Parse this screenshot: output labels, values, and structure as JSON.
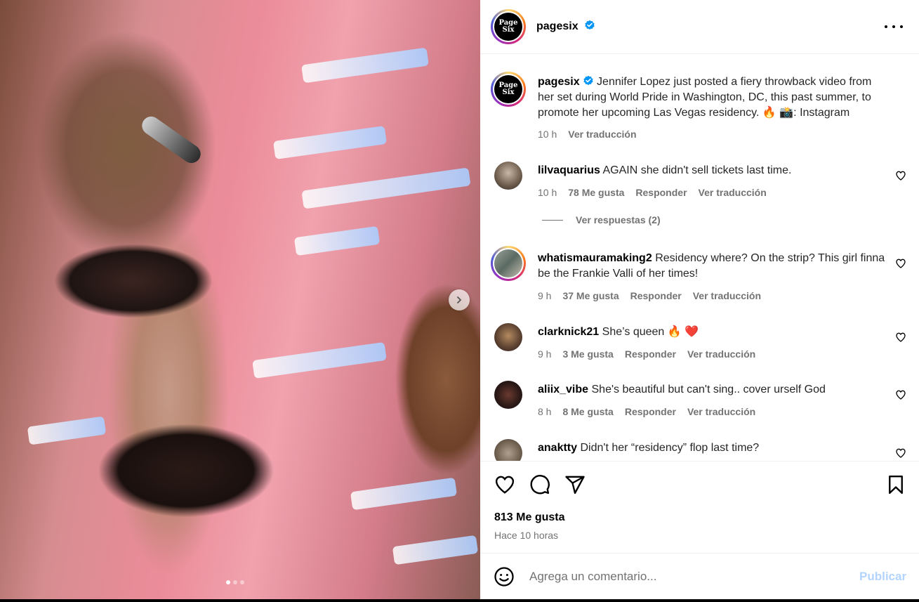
{
  "media": {
    "carousel_dots": 3,
    "active_dot": 1
  },
  "post": {
    "author": "pagesix",
    "avatar_text_line1": "Page",
    "avatar_text_line2": "Six",
    "caption_text": "Jennifer Lopez just posted a fiery throwback video from her set during World Pride in Washington, DC, this past summer, to promote her upcoming Las Vegas residency. 🔥 📸: Instagram",
    "caption_time": "10 h",
    "caption_translate": "Ver traducción"
  },
  "comments": [
    {
      "username": "lilvaquarius",
      "text": "AGAIN she didn't sell tickets last time.",
      "time": "10 h",
      "likes": "78 Me gusta",
      "reply": "Responder",
      "translate": "Ver traducción"
    },
    {
      "username": "whatismauramaking2",
      "text": "Residency where? On the strip? This girl finna be the Frankie Valli of her times!",
      "time": "9 h",
      "likes": "37 Me gusta",
      "reply": "Responder",
      "translate": "Ver traducción"
    },
    {
      "username": "clarknick21",
      "text": "She’s queen 🔥 ❤️",
      "time": "9 h",
      "likes": "3 Me gusta",
      "reply": "Responder",
      "translate": "Ver traducción"
    },
    {
      "username": "aliix_vibe",
      "text": "She's beautiful but can't sing.. cover urself God",
      "time": "8 h",
      "likes": "8 Me gusta",
      "reply": "Responder",
      "translate": "Ver traducción"
    },
    {
      "username": "anaktty",
      "text": "Didn't her “residency” flop last time?"
    }
  ],
  "view_replies": "Ver respuestas (2)",
  "footer": {
    "likes_count": "813 Me gusta",
    "time_ago": "Hace 10 horas",
    "comment_placeholder": "Agrega un comentario...",
    "publish_label": "Publicar"
  },
  "colors": {
    "verified": "#0095f6",
    "publish_disabled": "#b3d4fc",
    "meta_gray": "#737373"
  },
  "icons": {
    "header_more": "more-icon",
    "verified": "verified-badge-icon",
    "like": "heart-icon",
    "comment": "comment-icon",
    "share": "share-icon",
    "save": "bookmark-icon",
    "emoji": "emoji-icon",
    "next": "chevron-right-icon"
  }
}
